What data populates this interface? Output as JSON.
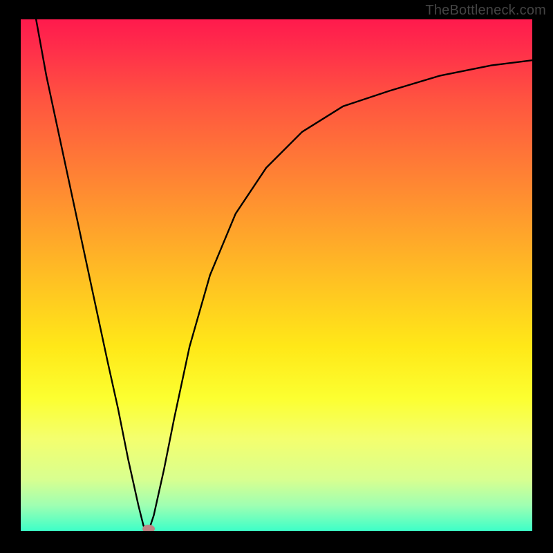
{
  "watermark": "TheBottleneck.com",
  "chart_data": {
    "type": "line",
    "title": "",
    "xlabel": "",
    "ylabel": "",
    "xlim": [
      0,
      100
    ],
    "ylim": [
      0,
      100
    ],
    "grid": false,
    "background_gradient": [
      "#ff1a4d",
      "#ffe818",
      "#3dffc8"
    ],
    "series": [
      {
        "name": "bottleneck-curve",
        "x": [
          3,
          5,
          8,
          11,
          14,
          17,
          19,
          21,
          23,
          24,
          25,
          26,
          28,
          30,
          33,
          37,
          42,
          48,
          55,
          63,
          72,
          82,
          92,
          100
        ],
        "values": [
          100,
          89,
          75,
          61,
          47,
          33,
          24,
          14,
          5,
          1,
          0,
          3,
          12,
          22,
          36,
          50,
          62,
          71,
          78,
          83,
          86,
          89,
          91,
          92
        ]
      }
    ],
    "markers": [
      {
        "name": "minimum-point",
        "x": 25,
        "y": 0,
        "shape": "ellipse",
        "color": "#bf8585"
      }
    ]
  }
}
